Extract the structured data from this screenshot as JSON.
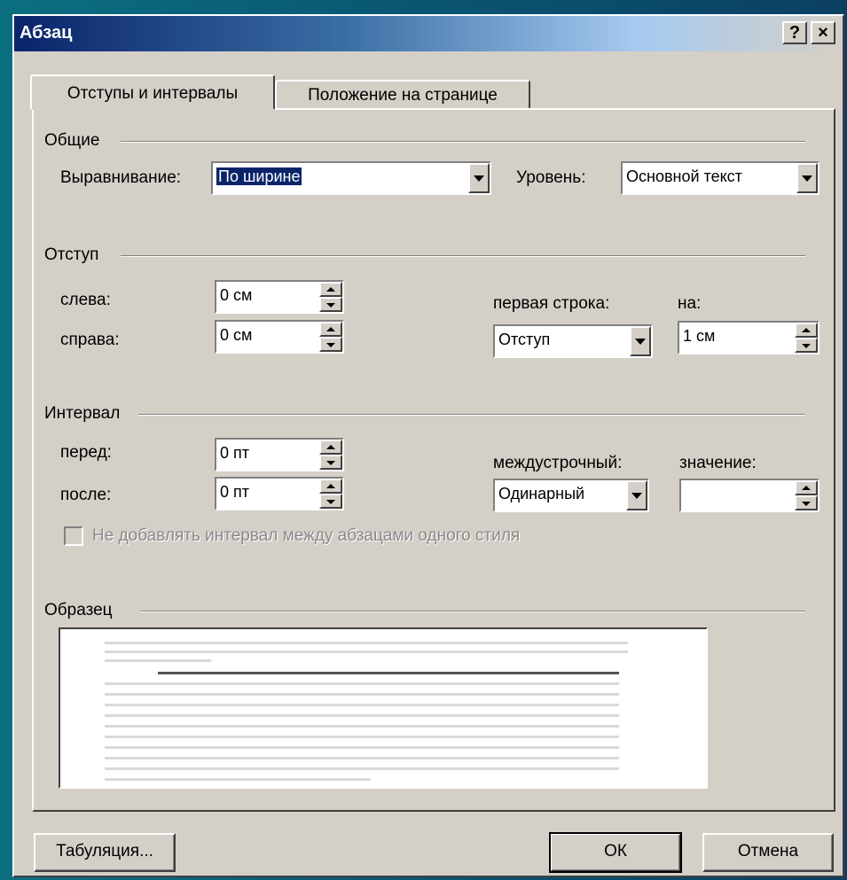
{
  "window": {
    "title": "Абзац",
    "help_label": "?",
    "close_label": "×"
  },
  "tabs": [
    {
      "label": "Отступы и интервалы",
      "active": true
    },
    {
      "label": "Положение на странице",
      "active": false
    }
  ],
  "general": {
    "group_label": "Общие",
    "alignment_label": "Выравнивание:",
    "alignment_value": "По ширине",
    "level_label": "Уровень:",
    "level_value": "Основной текст"
  },
  "indent": {
    "group_label": "Отступ",
    "left_label": "слева:",
    "left_value": "0 см",
    "right_label": "справа:",
    "right_value": "0 см",
    "first_line_label": "первая строка:",
    "first_line_value": "Отступ",
    "by_label": "на:",
    "by_value": "1 см"
  },
  "spacing": {
    "group_label": "Интервал",
    "before_label": "перед:",
    "before_value": "0 пт",
    "after_label": "после:",
    "after_value": "0 пт",
    "line_label": "междустрочный:",
    "line_value": "Одинарный",
    "value_label": "значение:",
    "value_value": ""
  },
  "dont_add_space": {
    "label": "Не добавлять интервал между абзацами одного стиля",
    "checked": false,
    "enabled": false
  },
  "preview": {
    "group_label": "Образец"
  },
  "buttons": {
    "tabs_label": "Табуляция...",
    "ok_label": "ОК",
    "cancel_label": "Отмена"
  },
  "colors": {
    "dialog_bg": "#d4d0c8",
    "titlebar_start": "#0a246a",
    "selection": "#0a246a",
    "desktop": "#0b6f80"
  }
}
